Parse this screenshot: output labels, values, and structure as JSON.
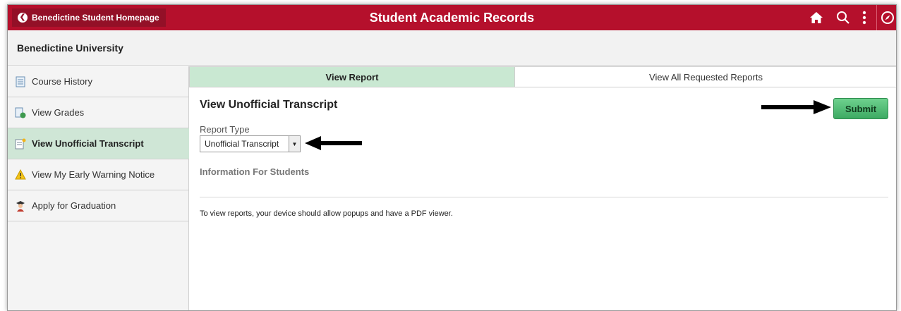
{
  "banner": {
    "back_label": "Benedictine Student Homepage",
    "title": "Student Academic Records",
    "bg_color": "#b5102c",
    "icons": [
      "home-icon",
      "search-icon",
      "more-actions-icon",
      "navbar-compass-icon"
    ]
  },
  "subheader": {
    "title": "Benedictine University"
  },
  "sidebar": {
    "items": [
      {
        "label": "Course History",
        "icon": "course-history-icon",
        "active": false
      },
      {
        "label": "View Grades",
        "icon": "grades-icon",
        "active": false
      },
      {
        "label": "View Unofficial Transcript",
        "icon": "transcript-icon",
        "active": true
      },
      {
        "label": "View My Early Warning Notice",
        "icon": "warning-icon",
        "active": false
      },
      {
        "label": "Apply for Graduation",
        "icon": "graduate-icon",
        "active": false
      }
    ]
  },
  "tabs": [
    {
      "label": "View Report",
      "active": true
    },
    {
      "label": "View All Requested Reports",
      "active": false
    }
  ],
  "main": {
    "title": "View Unofficial Transcript",
    "submit_label": "Submit",
    "report_type_label": "Report Type",
    "report_type_value": "Unofficial Transcript",
    "info_heading": "Information For Students",
    "note": "To view reports, your device should allow popups and have a PDF viewer."
  },
  "colors": {
    "accent": "#b5102c",
    "active_green": "#cfe6d6",
    "submit_green": "#4dbb72"
  }
}
